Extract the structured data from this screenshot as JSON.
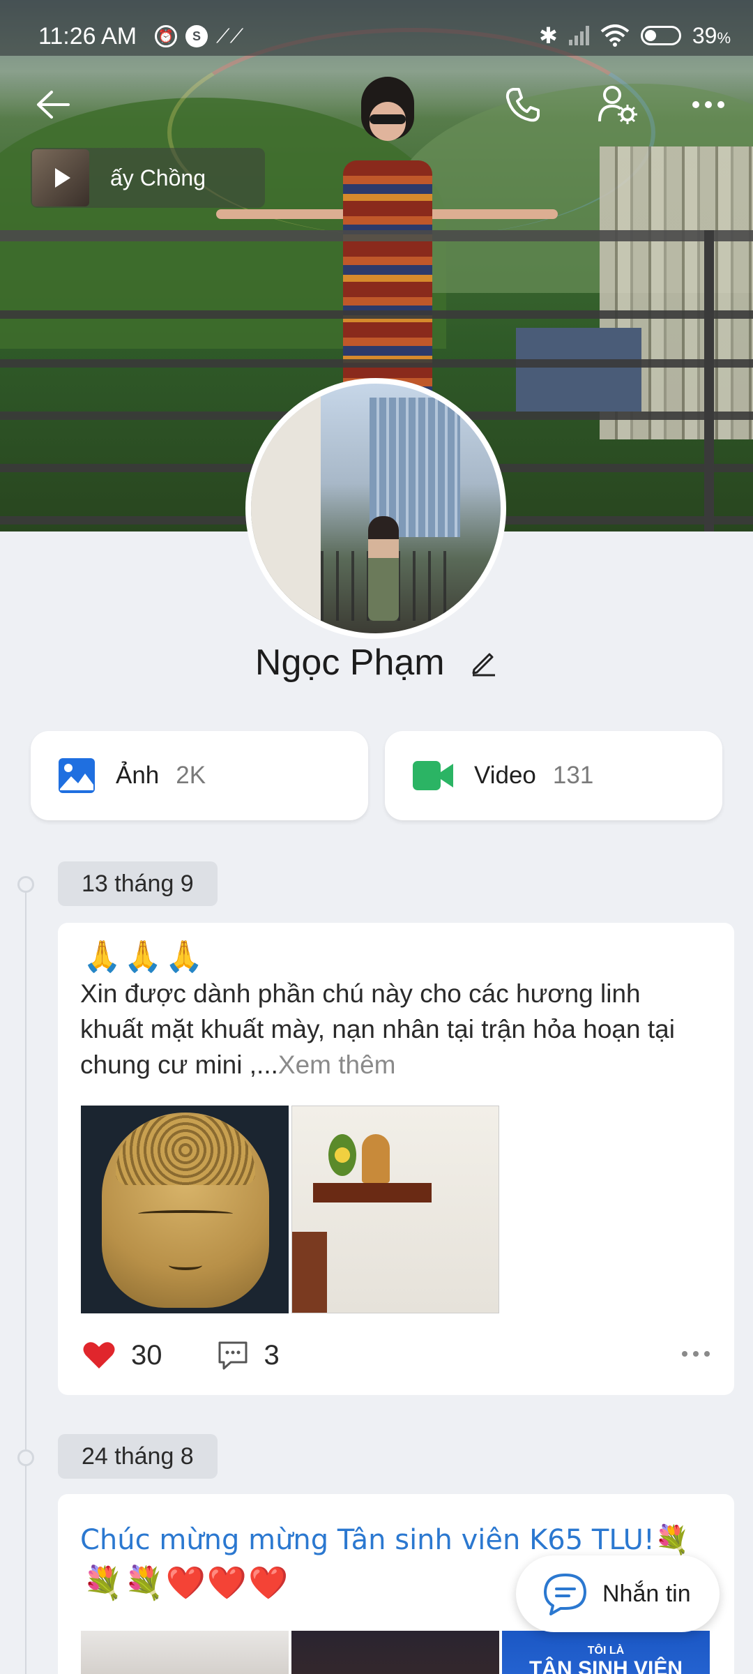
{
  "status_bar": {
    "time": "11:26 AM",
    "battery": "39",
    "battery_unit": "%"
  },
  "cover": {
    "music": {
      "title": "ấy Chồng"
    }
  },
  "profile": {
    "name": "Ngọc Phạm"
  },
  "media": {
    "photos": {
      "label": "Ảnh",
      "count": "2K"
    },
    "videos": {
      "label": "Video",
      "count": "131"
    }
  },
  "timeline": [
    {
      "date": "13 tháng 9",
      "emoji": "🙏🙏🙏",
      "text": "Xin được dành phần chú này cho các hương linh khuất mặt khuất mày, nạn nhân tại trận hỏa hoạn tại chung cư mini ,...",
      "more": "Xem thêm",
      "likes": "30",
      "comments": "3"
    },
    {
      "date": "24 tháng 8",
      "text": "Chúc mừng mừng Tân sinh viên K65 TLU!💐",
      "emoji": "💐💐❤️❤️❤️",
      "thumb_text_1": "TÔI LÀ",
      "thumb_text_2": "TÂN SINH VIÊN"
    }
  ],
  "fab": {
    "label": "Nhắn tin"
  },
  "colors": {
    "like": "#e0262c",
    "accent": "#2b78d0",
    "photo_icon": "#1f6fe0",
    "video_icon": "#2bb464"
  }
}
